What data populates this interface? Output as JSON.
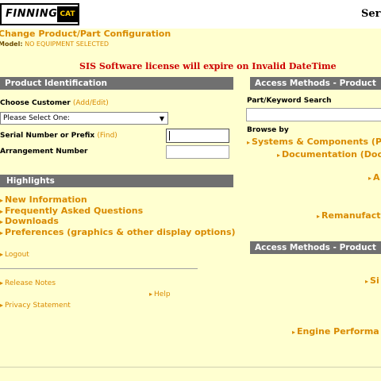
{
  "header": {
    "logo_text": "FINNING",
    "logo_mark": "CAT",
    "right_text": "Ser"
  },
  "page": {
    "title": "Change Product/Part Configuration",
    "model_label": "Model:",
    "model_value": "NO EQUIPMENT SELECTED",
    "license_notice": "SIS Software license will expire on Invalid DateTime"
  },
  "product_identification": {
    "header": "Product Identification",
    "choose_customer": "Choose Customer",
    "add_edit": "(Add/Edit)",
    "customer_select": "Please Select One:",
    "serial_label": "Serial Number or Prefix",
    "find_link": "(Find)",
    "arrangement_label": "Arrangement Number"
  },
  "highlights": {
    "header": "Highlights",
    "links": [
      "New Information",
      "Frequently Asked Questions",
      "Downloads",
      "Preferences (graphics & other display options)"
    ],
    "logout": "Logout",
    "release_notes": "Release Notes",
    "help": "Help",
    "privacy": "Privacy Statement"
  },
  "access_methods": {
    "header1": "Access Methods - Product",
    "part_search_label": "Part/Keyword Search",
    "browse_by": "Browse by",
    "browse_links": [
      "Systems & Components (P",
      "Documentation (Doc",
      "A",
      "Remanufact"
    ],
    "header2": "Access Methods - Product",
    "links2": [
      "Si",
      "Engine Performa"
    ]
  },
  "colors": {
    "background": "#ffffd0",
    "section_header": "#707070",
    "link_orange": "#d98a00",
    "license_red": "#cc0000"
  }
}
